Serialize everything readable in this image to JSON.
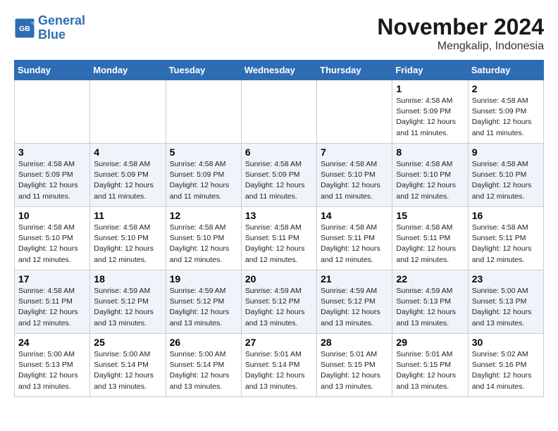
{
  "header": {
    "logo_line1": "General",
    "logo_line2": "Blue",
    "month": "November 2024",
    "location": "Mengkalip, Indonesia"
  },
  "weekdays": [
    "Sunday",
    "Monday",
    "Tuesday",
    "Wednesday",
    "Thursday",
    "Friday",
    "Saturday"
  ],
  "weeks": [
    [
      {
        "day": "",
        "info": ""
      },
      {
        "day": "",
        "info": ""
      },
      {
        "day": "",
        "info": ""
      },
      {
        "day": "",
        "info": ""
      },
      {
        "day": "",
        "info": ""
      },
      {
        "day": "1",
        "info": "Sunrise: 4:58 AM\nSunset: 5:09 PM\nDaylight: 12 hours\nand 11 minutes."
      },
      {
        "day": "2",
        "info": "Sunrise: 4:58 AM\nSunset: 5:09 PM\nDaylight: 12 hours\nand 11 minutes."
      }
    ],
    [
      {
        "day": "3",
        "info": "Sunrise: 4:58 AM\nSunset: 5:09 PM\nDaylight: 12 hours\nand 11 minutes."
      },
      {
        "day": "4",
        "info": "Sunrise: 4:58 AM\nSunset: 5:09 PM\nDaylight: 12 hours\nand 11 minutes."
      },
      {
        "day": "5",
        "info": "Sunrise: 4:58 AM\nSunset: 5:09 PM\nDaylight: 12 hours\nand 11 minutes."
      },
      {
        "day": "6",
        "info": "Sunrise: 4:58 AM\nSunset: 5:09 PM\nDaylight: 12 hours\nand 11 minutes."
      },
      {
        "day": "7",
        "info": "Sunrise: 4:58 AM\nSunset: 5:10 PM\nDaylight: 12 hours\nand 11 minutes."
      },
      {
        "day": "8",
        "info": "Sunrise: 4:58 AM\nSunset: 5:10 PM\nDaylight: 12 hours\nand 12 minutes."
      },
      {
        "day": "9",
        "info": "Sunrise: 4:58 AM\nSunset: 5:10 PM\nDaylight: 12 hours\nand 12 minutes."
      }
    ],
    [
      {
        "day": "10",
        "info": "Sunrise: 4:58 AM\nSunset: 5:10 PM\nDaylight: 12 hours\nand 12 minutes."
      },
      {
        "day": "11",
        "info": "Sunrise: 4:58 AM\nSunset: 5:10 PM\nDaylight: 12 hours\nand 12 minutes."
      },
      {
        "day": "12",
        "info": "Sunrise: 4:58 AM\nSunset: 5:10 PM\nDaylight: 12 hours\nand 12 minutes."
      },
      {
        "day": "13",
        "info": "Sunrise: 4:58 AM\nSunset: 5:11 PM\nDaylight: 12 hours\nand 12 minutes."
      },
      {
        "day": "14",
        "info": "Sunrise: 4:58 AM\nSunset: 5:11 PM\nDaylight: 12 hours\nand 12 minutes."
      },
      {
        "day": "15",
        "info": "Sunrise: 4:58 AM\nSunset: 5:11 PM\nDaylight: 12 hours\nand 12 minutes."
      },
      {
        "day": "16",
        "info": "Sunrise: 4:58 AM\nSunset: 5:11 PM\nDaylight: 12 hours\nand 12 minutes."
      }
    ],
    [
      {
        "day": "17",
        "info": "Sunrise: 4:58 AM\nSunset: 5:11 PM\nDaylight: 12 hours\nand 12 minutes."
      },
      {
        "day": "18",
        "info": "Sunrise: 4:59 AM\nSunset: 5:12 PM\nDaylight: 12 hours\nand 13 minutes."
      },
      {
        "day": "19",
        "info": "Sunrise: 4:59 AM\nSunset: 5:12 PM\nDaylight: 12 hours\nand 13 minutes."
      },
      {
        "day": "20",
        "info": "Sunrise: 4:59 AM\nSunset: 5:12 PM\nDaylight: 12 hours\nand 13 minutes."
      },
      {
        "day": "21",
        "info": "Sunrise: 4:59 AM\nSunset: 5:12 PM\nDaylight: 12 hours\nand 13 minutes."
      },
      {
        "day": "22",
        "info": "Sunrise: 4:59 AM\nSunset: 5:13 PM\nDaylight: 12 hours\nand 13 minutes."
      },
      {
        "day": "23",
        "info": "Sunrise: 5:00 AM\nSunset: 5:13 PM\nDaylight: 12 hours\nand 13 minutes."
      }
    ],
    [
      {
        "day": "24",
        "info": "Sunrise: 5:00 AM\nSunset: 5:13 PM\nDaylight: 12 hours\nand 13 minutes."
      },
      {
        "day": "25",
        "info": "Sunrise: 5:00 AM\nSunset: 5:14 PM\nDaylight: 12 hours\nand 13 minutes."
      },
      {
        "day": "26",
        "info": "Sunrise: 5:00 AM\nSunset: 5:14 PM\nDaylight: 12 hours\nand 13 minutes."
      },
      {
        "day": "27",
        "info": "Sunrise: 5:01 AM\nSunset: 5:14 PM\nDaylight: 12 hours\nand 13 minutes."
      },
      {
        "day": "28",
        "info": "Sunrise: 5:01 AM\nSunset: 5:15 PM\nDaylight: 12 hours\nand 13 minutes."
      },
      {
        "day": "29",
        "info": "Sunrise: 5:01 AM\nSunset: 5:15 PM\nDaylight: 12 hours\nand 13 minutes."
      },
      {
        "day": "30",
        "info": "Sunrise: 5:02 AM\nSunset: 5:16 PM\nDaylight: 12 hours\nand 14 minutes."
      }
    ]
  ]
}
